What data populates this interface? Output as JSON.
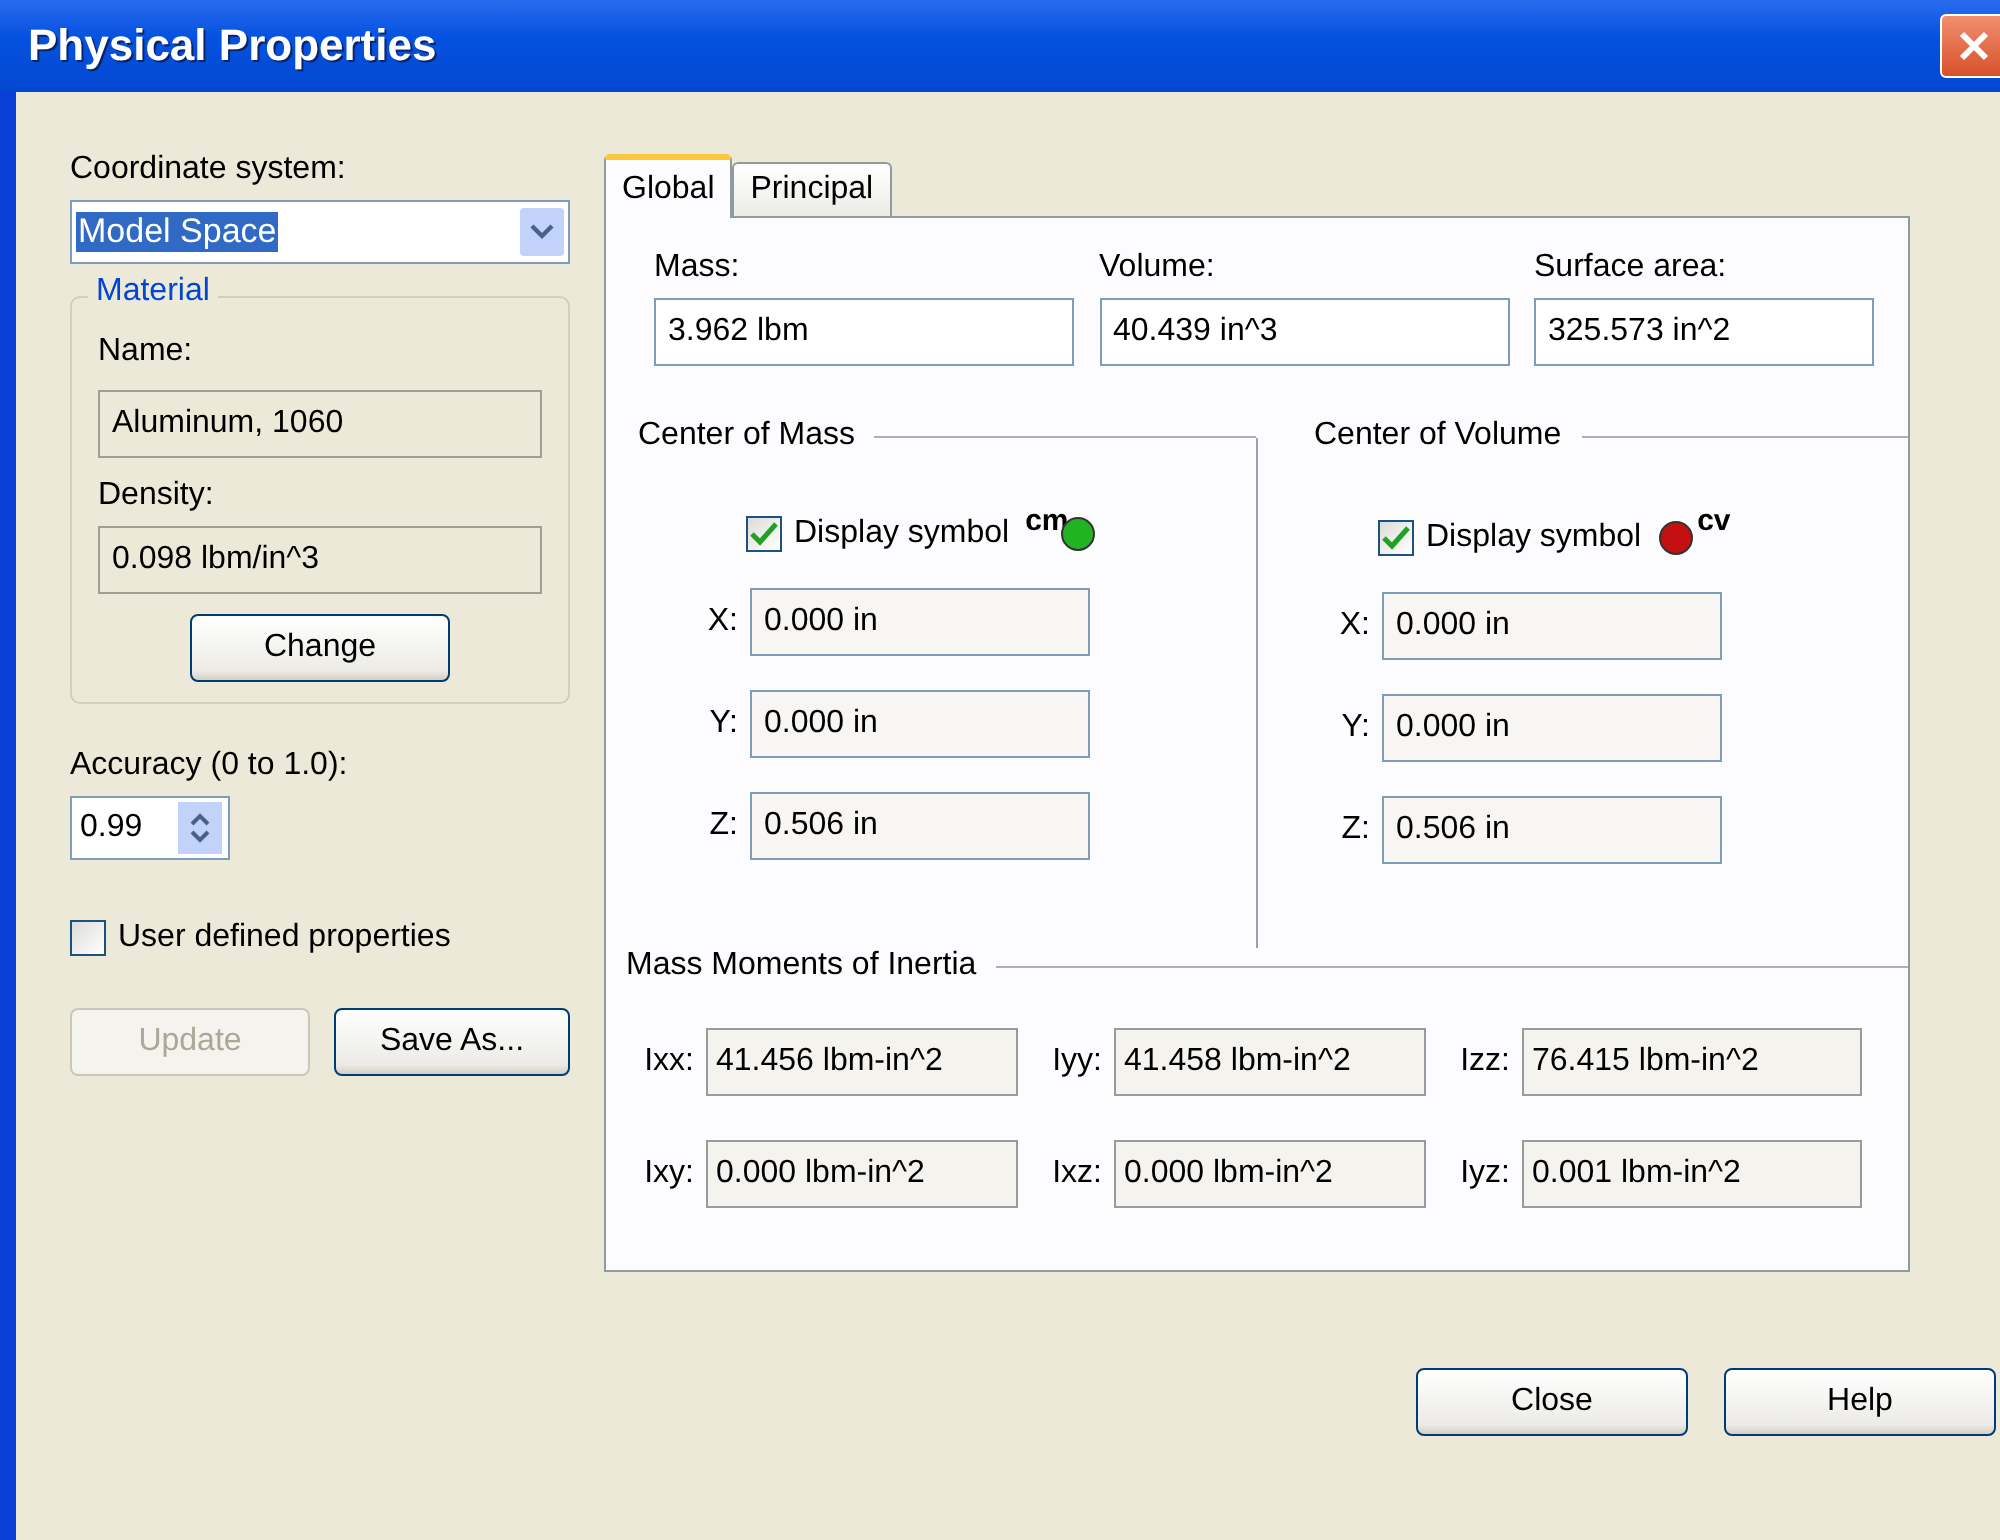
{
  "window": {
    "title": "Physical Properties"
  },
  "left": {
    "coordinate_label": "Coordinate system:",
    "coordinate_value": "Model Space",
    "material": {
      "legend": "Material",
      "name_label": "Name:",
      "name_value": "Aluminum, 1060",
      "density_label": "Density:",
      "density_value": "0.098 lbm/in^3",
      "button": "Change"
    },
    "accuracy_label": "Accuracy (0 to 1.0):",
    "accuracy_value": "0.99",
    "user_defined": {
      "label": "User defined properties",
      "checked": false
    },
    "buttons": [
      {
        "label": "Update",
        "disabled": true
      },
      {
        "label": "Save As...",
        "disabled": false
      }
    ]
  },
  "tabs": [
    {
      "label": "Global",
      "selected": true
    },
    {
      "label": "Principal",
      "selected": false
    }
  ],
  "summary": [
    {
      "label": "Mass:",
      "value": "3.962 lbm"
    },
    {
      "label": "Volume:",
      "value": "40.439 in^3"
    },
    {
      "label": "Surface area:",
      "value": "325.573 in^2"
    }
  ],
  "centers": [
    {
      "title": "Center of Mass",
      "display": {
        "label": "Display symbol",
        "checked": true
      },
      "symbol": "cm",
      "color": "#22b322",
      "coords": [
        {
          "axis": "X:",
          "value": "0.000 in"
        },
        {
          "axis": "Y:",
          "value": "0.000 in"
        },
        {
          "axis": "Z:",
          "value": "0.506 in"
        }
      ]
    },
    {
      "title": "Center of Volume",
      "display": {
        "label": "Display symbol",
        "checked": true
      },
      "symbol": "cv",
      "color": "#c41010",
      "coords": [
        {
          "axis": "X:",
          "value": "0.000 in"
        },
        {
          "axis": "Y:",
          "value": "0.000 in"
        },
        {
          "axis": "Z:",
          "value": "0.506 in"
        }
      ]
    }
  ],
  "inertia": {
    "title": "Mass Moments of Inertia",
    "rows": [
      [
        {
          "label": "Ixx:",
          "value": "41.456 lbm-in^2"
        },
        {
          "label": "Iyy:",
          "value": "41.458 lbm-in^2"
        },
        {
          "label": "Izz:",
          "value": "76.415 lbm-in^2"
        }
      ],
      [
        {
          "label": "Ixy:",
          "value": "0.000 lbm-in^2"
        },
        {
          "label": "Ixz:",
          "value": "0.000 lbm-in^2"
        },
        {
          "label": "Iyz:",
          "value": "0.001 lbm-in^2"
        }
      ]
    ]
  },
  "footer": [
    "Close",
    "Help"
  ]
}
